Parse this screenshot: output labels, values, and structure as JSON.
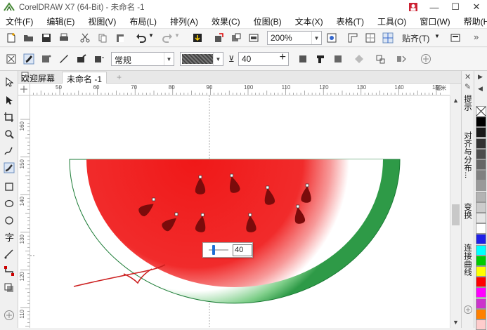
{
  "app": {
    "title": "CorelDRAW X7 (64-Bit) - 未命名 -1",
    "window_minimize": "—",
    "window_maximize": "☐",
    "window_close": "✕"
  },
  "menu": [
    "文件(F)",
    "编辑(E)",
    "视图(V)",
    "布局(L)",
    "排列(A)",
    "效果(C)",
    "位图(B)",
    "文本(X)",
    "表格(T)",
    "工具(O)",
    "窗口(W)",
    "帮助(H)"
  ],
  "standard_toolbar": {
    "zoom_value": "200%",
    "snap_label": "贴齐(T)",
    "more": "»"
  },
  "property_bar": {
    "brush_style": "常规",
    "nib_size": "40"
  },
  "tabs": {
    "welcome": "欢迎屏幕",
    "document": "未命名 -1",
    "add": "+"
  },
  "rulers": {
    "h_ticks": [
      "50",
      "60",
      "70",
      "80",
      "90",
      "100",
      "110",
      "120",
      "130",
      "140",
      "150"
    ],
    "h_unit": "毫米",
    "v_ticks": [
      "160",
      "150",
      "140",
      "130",
      "120",
      "110"
    ]
  },
  "dockers": [
    "提示",
    "对齐与分布...",
    "变换",
    "连接曲线"
  ],
  "size_popup": {
    "value": "40"
  },
  "palette": [
    "#ffffff",
    "#000000",
    "#1a1a1a",
    "#333333",
    "#4d4d4d",
    "#666666",
    "#808080",
    "#999999",
    "#b3b3b3",
    "#cccccc",
    "#e6e6e6",
    "#ffffff",
    "#1f1fe6",
    "#00ffff",
    "#00cc00",
    "#ffff00",
    "#ff0000",
    "#ff00ff",
    "#cc33cc",
    "#ff8000",
    "#ffcccc"
  ],
  "watermelon": {
    "rind": "#2e9a47",
    "flesh": "#f01818",
    "seed": "#7b0b0b"
  }
}
